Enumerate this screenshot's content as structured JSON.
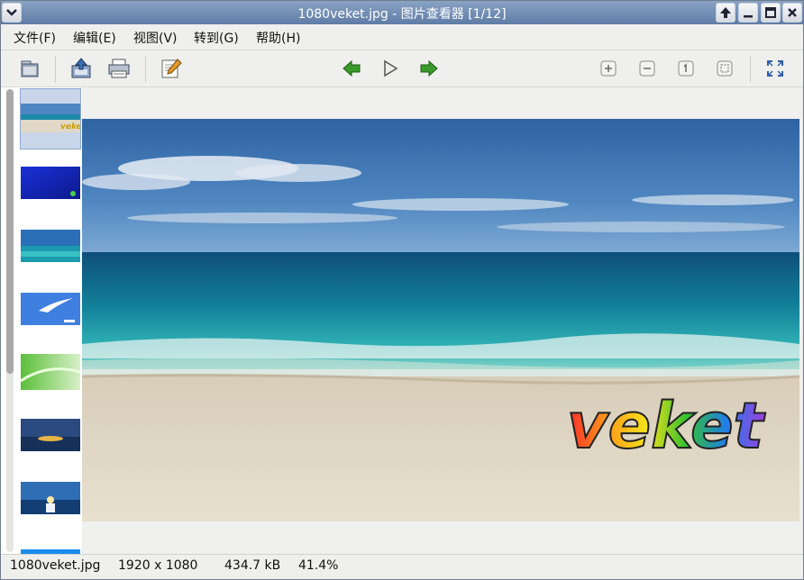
{
  "window": {
    "title": "1080veket.jpg - 图片查看器 [1/12]",
    "buttons": [
      "window-menu-icon",
      "up-arrow-icon",
      "minimize-icon",
      "maximize-icon",
      "close-icon"
    ]
  },
  "menu": {
    "items": [
      "文件(F)",
      "编辑(E)",
      "视图(V)",
      "转到(G)",
      "帮助(H)"
    ]
  },
  "toolbar": {
    "icons": [
      "open-folder-icon",
      "save-icon",
      "print-icon",
      "edit-icon",
      "back-arrow-icon",
      "play-icon",
      "forward-arrow-icon",
      "zoom-in-icon",
      "zoom-out-icon",
      "zoom-100-icon",
      "zoom-fit-icon",
      "fullscreen-icon"
    ]
  },
  "thumbnails": {
    "count_visible": 8,
    "selected_index": 0
  },
  "image": {
    "watermark": "veket"
  },
  "status": {
    "filename": "1080veket.jpg",
    "dimensions": "1920 x 1080",
    "filesize": "434.7 kB",
    "zoom": "41.4%"
  },
  "colors": {
    "titlebar": "#6f8bb3",
    "accent_green": "#3a9a2a",
    "selection": "#c9d6ea"
  }
}
